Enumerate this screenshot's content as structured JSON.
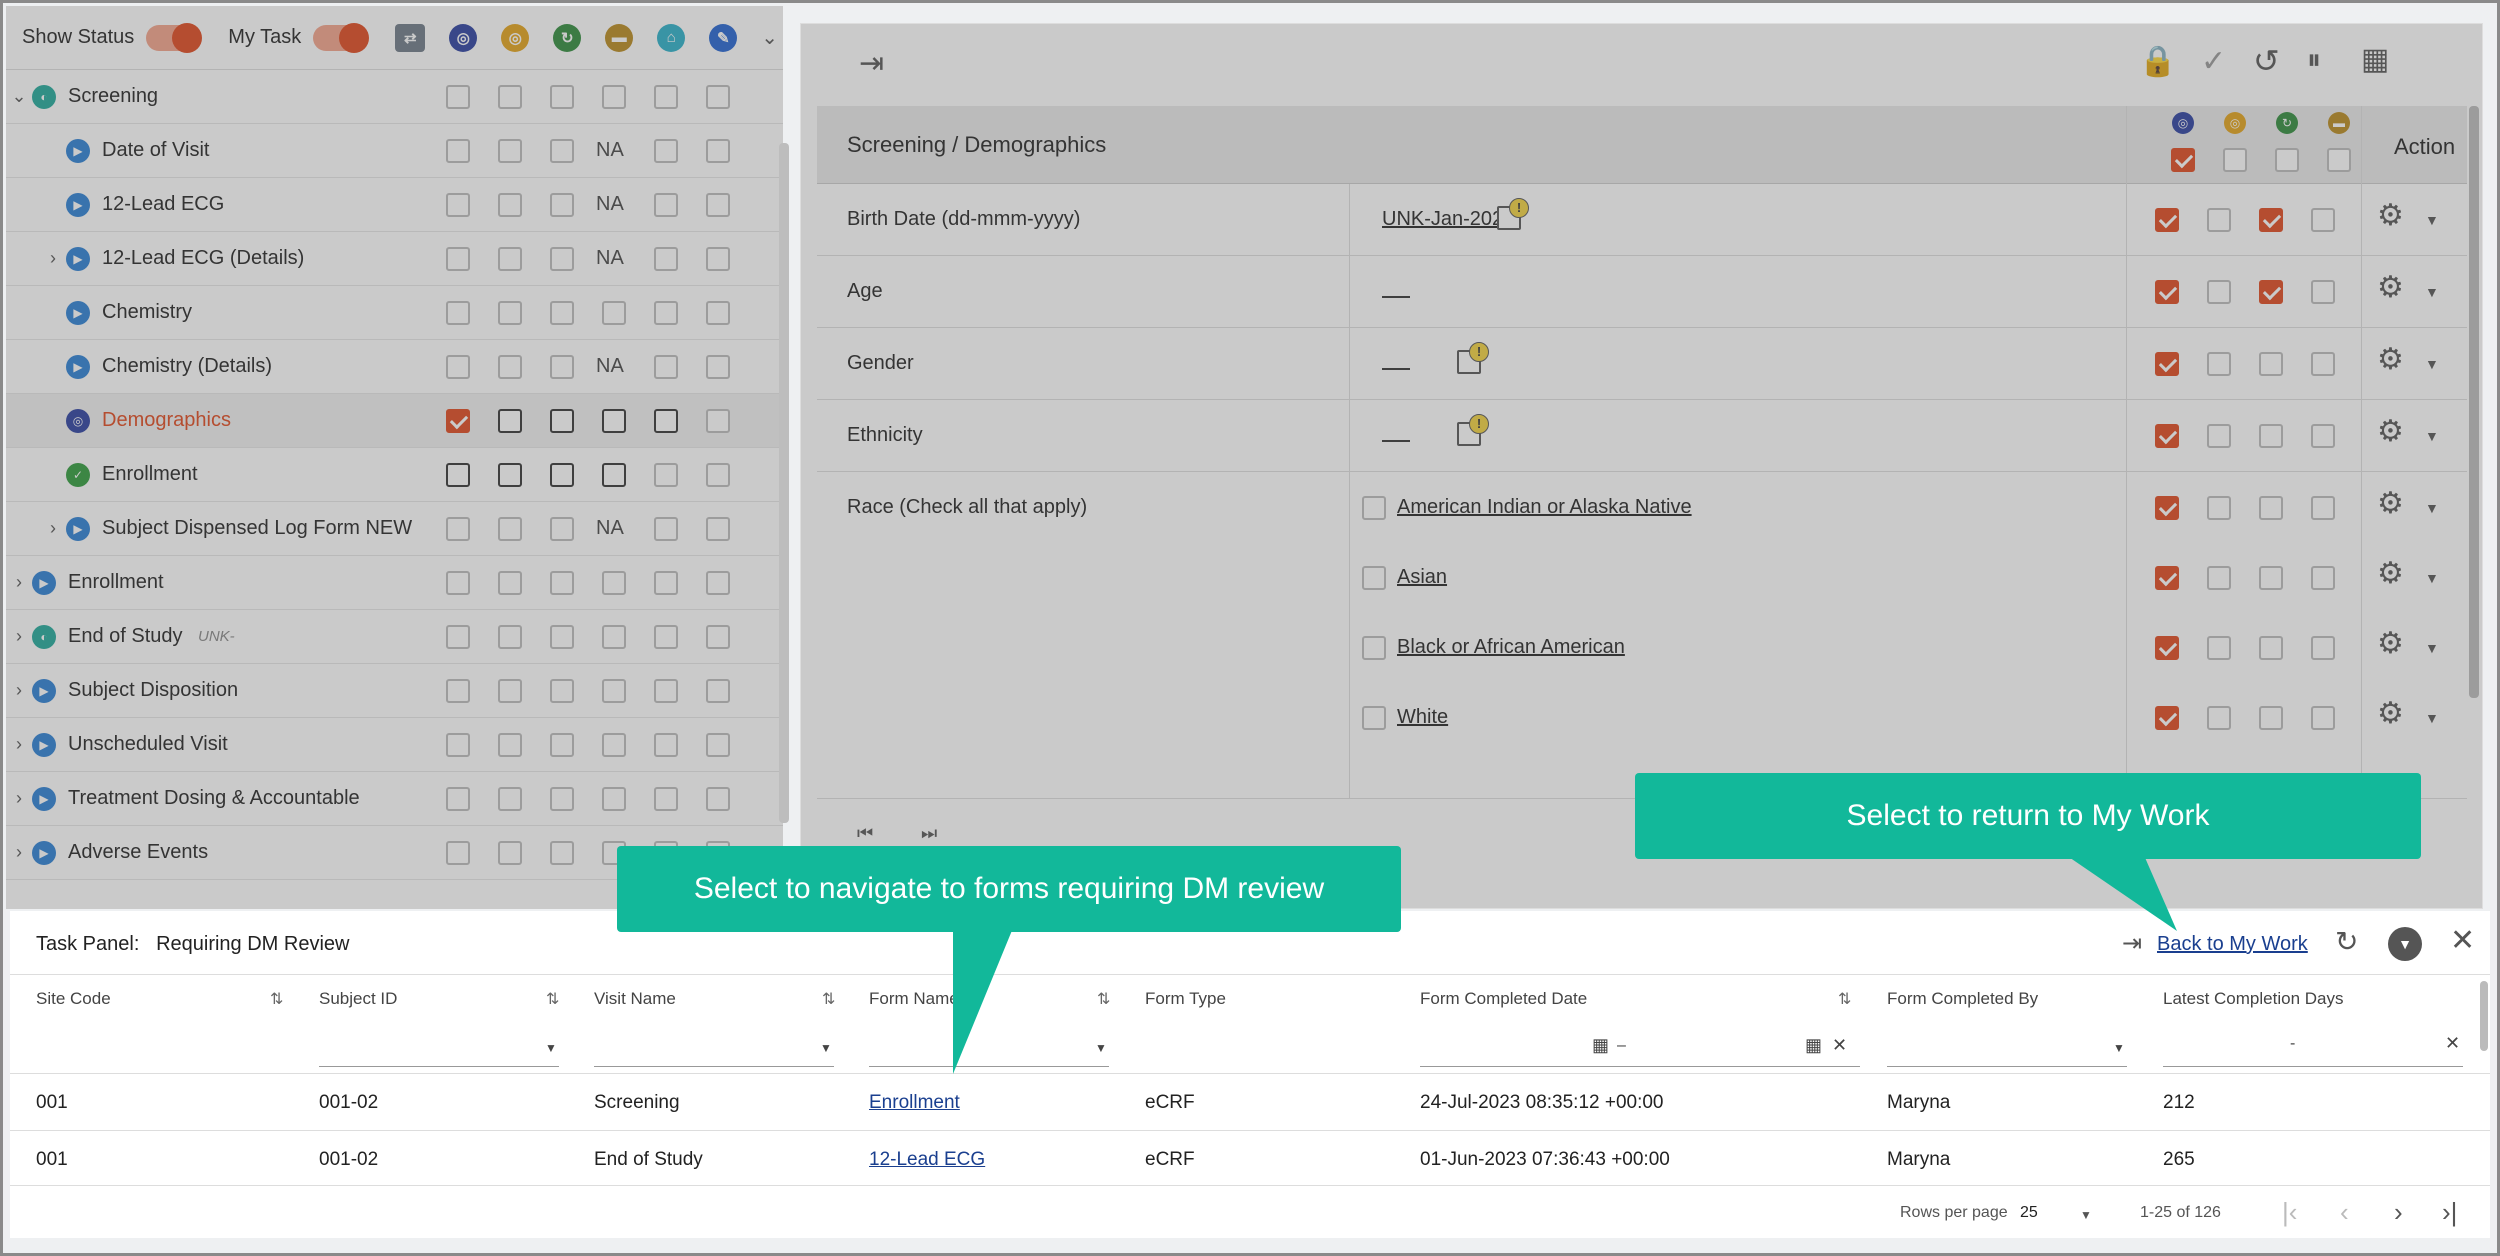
{
  "left_panel": {
    "show_status_label": "Show Status",
    "my_task_label": "My Task",
    "na_text": "NA",
    "items": [
      {
        "label": "Screening",
        "level": 0,
        "expanded": true
      },
      {
        "label": "Date of Visit",
        "level": 1
      },
      {
        "label": "12-Lead ECG",
        "level": 1
      },
      {
        "label": "12-Lead ECG (Details)",
        "level": 1
      },
      {
        "label": "Chemistry",
        "level": 1
      },
      {
        "label": "Chemistry (Details)",
        "level": 1
      },
      {
        "label": "Demographics",
        "level": 1
      },
      {
        "label": "Enrollment",
        "level": 1
      },
      {
        "label": "Subject Dispensed Log Form NEW",
        "level": 1
      },
      {
        "label": "Enrollment",
        "level": 0
      },
      {
        "label": "End of Study",
        "level": 0,
        "hint": "UNK-"
      },
      {
        "label": "Subject Disposition",
        "level": 0
      },
      {
        "label": "Unscheduled Visit",
        "level": 0
      },
      {
        "label": "Treatment Dosing & Accountable",
        "level": 0
      },
      {
        "label": "Adverse Events",
        "level": 0
      }
    ]
  },
  "form": {
    "section_title": "Screening / Demographics",
    "action_header": "Action",
    "rows": [
      {
        "question": "Birth Date (dd-mmm-yyyy)",
        "value": "UNK-Jan-2021"
      },
      {
        "question": "Age",
        "value": ""
      },
      {
        "question": "Gender",
        "value": ""
      },
      {
        "question": "Ethnicity",
        "value": ""
      },
      {
        "question": "Race (Check all that apply)",
        "value": ""
      }
    ],
    "race_options": [
      "American Indian or Alaska Native",
      "Asian",
      "Black or African American",
      "White"
    ]
  },
  "callouts": {
    "return": "Select to return to My Work",
    "navigate": "Select to navigate to forms requiring DM review"
  },
  "task_panel": {
    "label": "Task Panel:",
    "title": "Requiring DM Review",
    "back_link": "Back to My Work",
    "columns": [
      "Site Code",
      "Subject ID",
      "Visit Name",
      "Form Name",
      "Form Type",
      "Form Completed Date",
      "Form Completed By",
      "Latest Completion Days"
    ],
    "date_range_sep": "–",
    "days_range_sep": "-",
    "rows": [
      {
        "site": "001",
        "subject": "001-02",
        "visit": "Screening",
        "form": "Enrollment",
        "type": "eCRF",
        "date": "24-Jul-2023 08:35:12 +00:00",
        "by": "Maryna",
        "days": "212"
      },
      {
        "site": "001",
        "subject": "001-02",
        "visit": "End of Study",
        "form": "12-Lead ECG",
        "type": "eCRF",
        "date": "01-Jun-2023 07:36:43 +00:00",
        "by": "Maryna",
        "days": "265"
      }
    ],
    "rows_per_page_label": "Rows per page",
    "rows_per_page_value": "25",
    "range_text": "1-25 of 126"
  },
  "colors": {
    "accent": "#e0481c",
    "callout": "#12b89a",
    "link": "#1a3f8f"
  }
}
